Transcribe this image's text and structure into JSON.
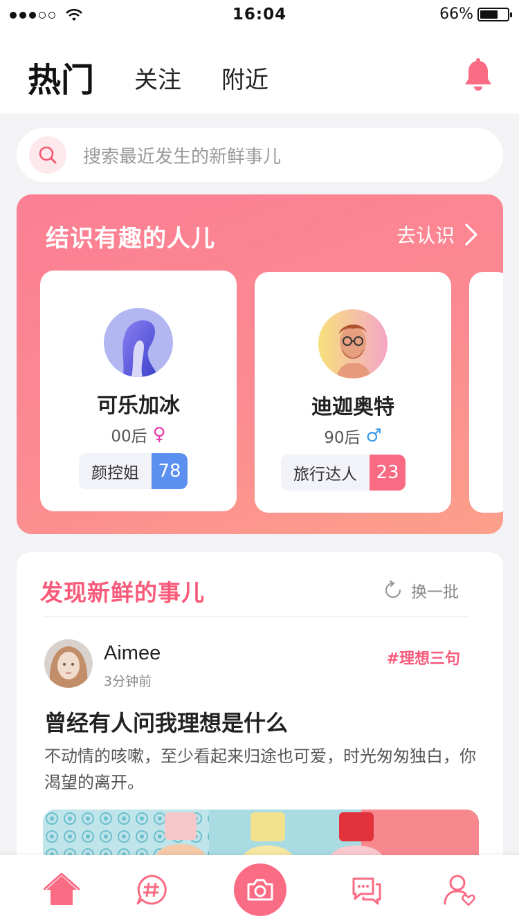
{
  "status_bar": {
    "time": "16:04",
    "battery_text": "66%",
    "battery_level": 0.66,
    "signal_bars": 3,
    "signal_total": 5
  },
  "header": {
    "tabs": [
      {
        "label": "热门",
        "active": true
      },
      {
        "label": "关注",
        "active": false
      },
      {
        "label": "附近",
        "active": false
      }
    ],
    "bell_icon": "bell-icon"
  },
  "search": {
    "placeholder": "搜索最近发生的新鲜事儿",
    "icon": "search-icon"
  },
  "people": {
    "title": "结识有趣的人儿",
    "more_label": "去认识",
    "cards": [
      {
        "name": "可乐加冰",
        "age": "00后",
        "gender": "♀",
        "tag": "颜控姐",
        "score": "78",
        "score_color": "#5b8ff0"
      },
      {
        "name": "迪迦奥特",
        "age": "90后",
        "gender": "♂",
        "tag": "旅行达人",
        "score": "23",
        "score_color": "#f86b83"
      }
    ]
  },
  "discover": {
    "title": "发现新鲜的事儿",
    "refresh_label": "换一批",
    "post": {
      "user": "Aimee",
      "time": "3分钟前",
      "tag": "#理想三句",
      "title": "曾经有人问我理想是什么",
      "body": "不动情的咳嗽，至少看起来归途也可爱，时光匆匆独白，你渴望的离开。"
    }
  },
  "tabbar": {
    "items": [
      {
        "icon": "home-icon"
      },
      {
        "icon": "hashtag-icon"
      },
      {
        "icon": "camera-icon"
      },
      {
        "icon": "message-icon"
      },
      {
        "icon": "profile-icon"
      }
    ],
    "accent": "#fa6b84"
  }
}
